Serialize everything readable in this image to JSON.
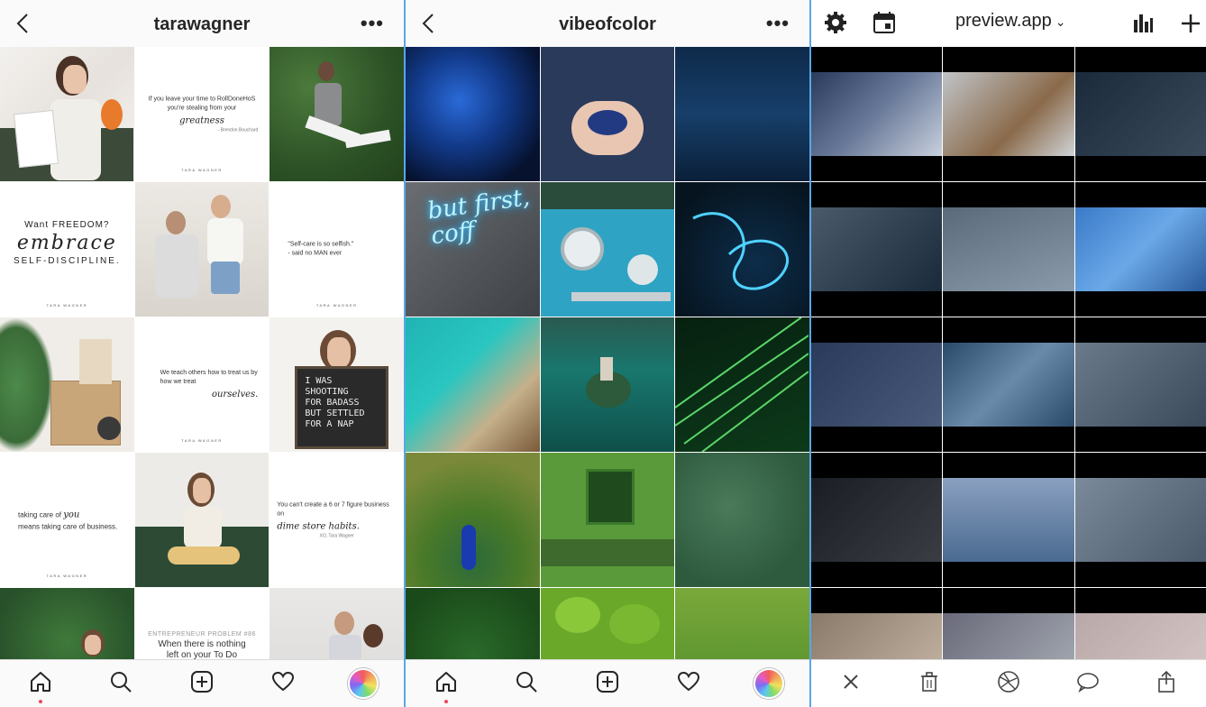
{
  "panel1": {
    "username": "tarawagner",
    "more_label": "•••",
    "quote_greatness": "If you leave your time to RollDoneHoS you're stealing from your",
    "quote_greatness_script": "greatness",
    "quote_greatness_author": "- Brendon Bouchard",
    "freedom_line1": "Want FREEDOM?",
    "freedom_line2": "embrace",
    "freedom_line3": "SELF-DISCIPLINE.",
    "selfcare_line1": "\"Self-care is so selfish.\"",
    "selfcare_line2": "- said no MAN ever",
    "teach_line": "We teach others how to treat us by how we treat",
    "teach_script": "ourselves.",
    "letterboard": "I WAS\nSHOOTING\nFOR BADASS\nBUT SETTLED\nFOR A NAP",
    "care_line1": "taking care of",
    "care_script": "you",
    "care_line2": "means taking care of business.",
    "sixfig_line": "You can't create a 6 or 7 figure business on",
    "sixfig_script": "dime store habits.",
    "sixfig_author": "XO, Tara Wagner",
    "entre_label": "ENTREPRENEUR PROBLEM #86",
    "entre_text": "When there is nothing left on your To Do list...and",
    "brand_tag": "TARA WAGNER"
  },
  "panel2": {
    "username": "vibeofcolor",
    "more_label": "•••",
    "neon_text": "but first, coff"
  },
  "panel3": {
    "title": "preview.app",
    "chevron": "⌄"
  },
  "colors": {
    "divider": "#5aa6e6",
    "accent_dot": "#ed4956"
  },
  "icons": {
    "home": "home-icon",
    "search": "search-icon",
    "add": "plus-square-icon",
    "heart": "heart-icon",
    "profile": "avatar"
  }
}
